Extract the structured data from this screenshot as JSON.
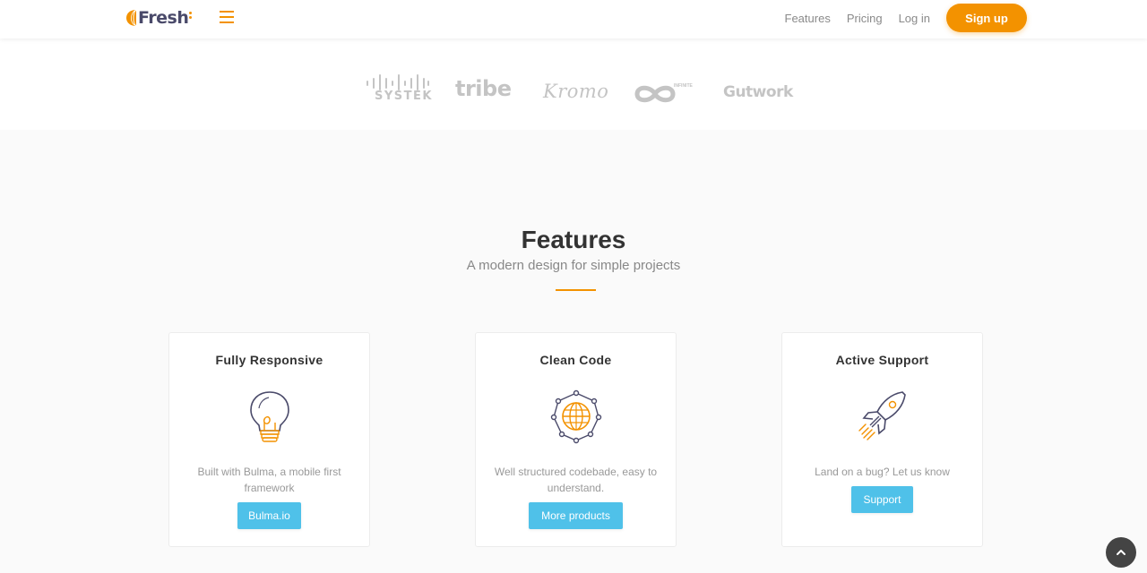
{
  "brand": {
    "name": "Fresh",
    "accent_color": "#f39200",
    "text_color": "#4a4a6a",
    "icon": "fresh-logo-icon"
  },
  "navbar": {
    "menu_icon": "hamburger-icon",
    "links": [
      "Features",
      "Pricing",
      "Log in"
    ],
    "signup_label": "Sign up"
  },
  "clients": {
    "logos": [
      "SYSTEK",
      "tribe",
      "Kromo",
      "INFINITE",
      "Gutwork"
    ]
  },
  "features": {
    "title": "Features",
    "subtitle": "A modern design for simple projects",
    "cards": [
      {
        "title": "Fully Responsive",
        "icon": "lightbulb-icon",
        "text": "Built with Bulma, a mobile first framework",
        "button": "Bulma.io"
      },
      {
        "title": "Clean Code",
        "icon": "globe-network-icon",
        "text": "Well structured codebade, easy to understand.",
        "button": "More products"
      },
      {
        "title": "Active Support",
        "icon": "rocket-icon",
        "text": "Land on a bug? Let us know",
        "button": "Support"
      }
    ]
  },
  "back_to_top": {
    "icon": "chevron-up-icon"
  },
  "colors": {
    "accent": "#f39200",
    "button_blue": "#4fc1e9",
    "section_bg": "#fafafa"
  }
}
